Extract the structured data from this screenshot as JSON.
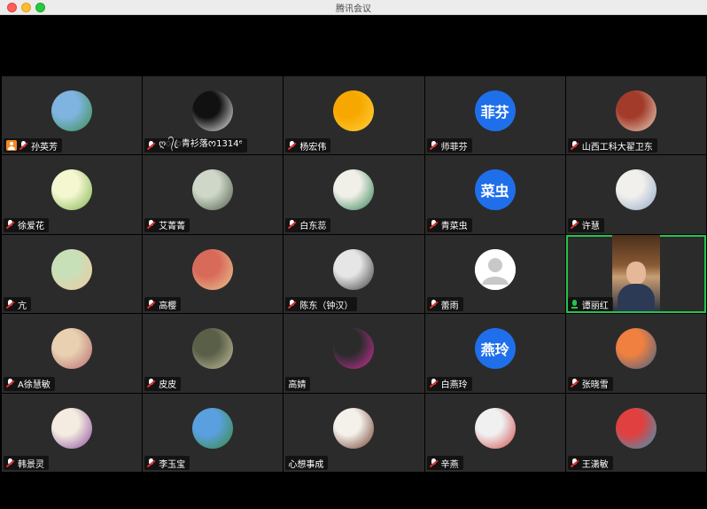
{
  "window": {
    "title": "腾讯会议"
  },
  "participants": [
    {
      "name": "孙英芳",
      "avatar": "photo",
      "colors": [
        "#7fb4e0",
        "#3a8e4a"
      ],
      "host": true
    },
    {
      "name": "ღ᭄ꦿ青衫落ᰔ1314ᵉ",
      "avatar": "photo",
      "colors": [
        "#111111",
        "#f2f2f2"
      ]
    },
    {
      "name": "杨宏伟",
      "avatar": "photo",
      "colors": [
        "#f7a800",
        "#ffd23d"
      ]
    },
    {
      "name": "师菲芬",
      "avatar": "text",
      "avatar_text": "菲芬"
    },
    {
      "name": "山西工科大翟卫东",
      "avatar": "photo",
      "colors": [
        "#a33b2a",
        "#e8d4c0"
      ]
    },
    {
      "name": "徐爱花",
      "avatar": "photo",
      "colors": [
        "#f5f7d0",
        "#7bb24c"
      ]
    },
    {
      "name": "艾菁菁",
      "avatar": "photo",
      "colors": [
        "#cfd8c8",
        "#4d5a48"
      ]
    },
    {
      "name": "白东蕊",
      "avatar": "photo",
      "colors": [
        "#f0f0e8",
        "#2e7d4f"
      ]
    },
    {
      "name": "青菜虫",
      "avatar": "text",
      "avatar_text": "菜虫"
    },
    {
      "name": "许慧",
      "avatar": "photo",
      "colors": [
        "#f2f0ec",
        "#8fa8c8"
      ]
    },
    {
      "name": "亢",
      "avatar": "photo",
      "colors": [
        "#c8e0b8",
        "#f0c8a0"
      ]
    },
    {
      "name": "高樱",
      "avatar": "photo",
      "colors": [
        "#d86a5a",
        "#e8c890"
      ]
    },
    {
      "name": "陈东（钟汉）",
      "avatar": "photo",
      "colors": [
        "#e6e6e6",
        "#3a3a3a"
      ]
    },
    {
      "name": "蕾雨",
      "avatar": "default"
    },
    {
      "name": "谭丽红",
      "avatar": "video",
      "speaking": true
    },
    {
      "name": "A徐慧敏",
      "avatar": "photo",
      "colors": [
        "#e8d0b0",
        "#b86a70"
      ]
    },
    {
      "name": "皮皮",
      "avatar": "photo",
      "colors": [
        "#5a6048",
        "#c8c0a0"
      ]
    },
    {
      "name": "高婧",
      "avatar": "photo",
      "colors": [
        "#2b2b2b",
        "#d030a0"
      ],
      "no_mic": true
    },
    {
      "name": "白燕玲",
      "avatar": "text",
      "avatar_text": "燕玲"
    },
    {
      "name": "张晓雪",
      "avatar": "photo",
      "colors": [
        "#f08040",
        "#40608c"
      ]
    },
    {
      "name": "韩景灵",
      "avatar": "photo",
      "colors": [
        "#f4ece0",
        "#8a4aa0"
      ]
    },
    {
      "name": "李玉宝",
      "avatar": "photo",
      "colors": [
        "#5aa0e0",
        "#3a8a3a"
      ]
    },
    {
      "name": "心想事成",
      "avatar": "photo",
      "colors": [
        "#f4f0ea",
        "#6a3a2a"
      ],
      "no_mic": true
    },
    {
      "name": "辛燕",
      "avatar": "photo",
      "colors": [
        "#f0f0f0",
        "#d04a4a"
      ]
    },
    {
      "name": "王潇敏",
      "avatar": "photo",
      "colors": [
        "#e04040",
        "#30a0c0"
      ]
    }
  ]
}
